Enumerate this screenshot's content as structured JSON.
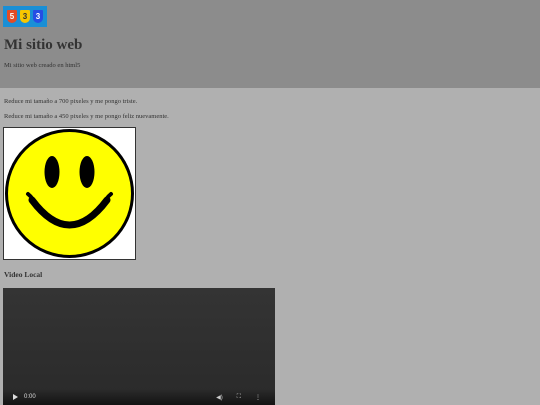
{
  "header": {
    "logo": [
      "5",
      "3",
      "3"
    ],
    "title": "Mi sitio web",
    "subtitle": "Mi sitio web creado en html5"
  },
  "main": {
    "text1": "Reduce mi tamaño a 700 pixeles y me pongo triste.",
    "text2": "Reduce mi tamaño a 450 pixeles y me pongo feliz nuevamente.",
    "video_title": "Video Local",
    "video": {
      "time": "0:00",
      "progress": 0
    }
  },
  "colors": {
    "background": "#b0b0b0",
    "header": "#8c8c8c",
    "smiley_face": "#ffff00",
    "logo_bg": "#1a8fd6"
  }
}
